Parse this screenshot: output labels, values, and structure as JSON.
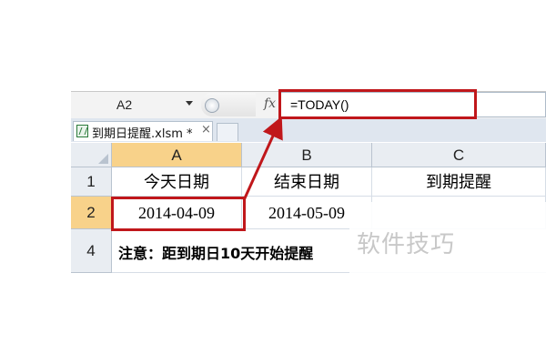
{
  "formula_bar": {
    "name_box": "A2",
    "fx": "fx",
    "formula": "=TODAY()"
  },
  "workbook_tab": {
    "label": "到期日提醒.xlsm *",
    "close": "×"
  },
  "columns": [
    "A",
    "B",
    "C"
  ],
  "rows": [
    "1",
    "2",
    "4"
  ],
  "cells": {
    "A1": "今天日期",
    "B1": "结束日期",
    "C1": "到期提醒",
    "A2": "2014-04-09",
    "B2": "2014-05-09",
    "note": "注意：距到期日10天开始提醒"
  },
  "watermark": "软件技巧",
  "colors": {
    "annotation": "#c0171b",
    "active_header": "#f8d28a",
    "header_bg": "#e9edf2"
  }
}
